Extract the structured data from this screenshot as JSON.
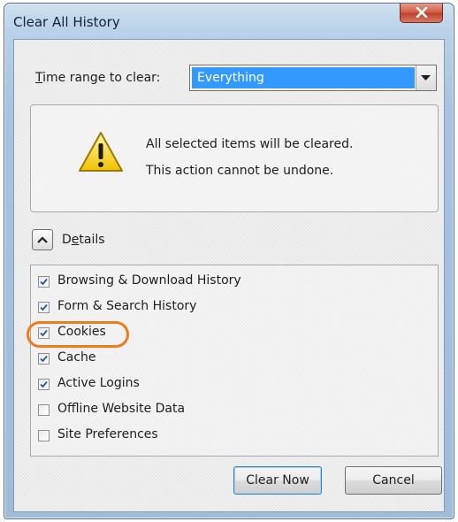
{
  "window": {
    "title": "Clear All History"
  },
  "time_range": {
    "label_accel": "T",
    "label_rest": "ime range to clear:",
    "selected": "Everything"
  },
  "warning": {
    "line1": "All selected items will be cleared.",
    "line2": "This action cannot be undone.",
    "icon": "warning-triangle-icon"
  },
  "details": {
    "label_pre": "D",
    "label_accel": "e",
    "label_post": "tails",
    "expanded": true
  },
  "items": [
    {
      "label": "Browsing & Download History",
      "checked": true
    },
    {
      "label": "Form & Search History",
      "checked": true
    },
    {
      "label": "Cookies",
      "checked": true
    },
    {
      "label": "Cache",
      "checked": true
    },
    {
      "label": "Active Logins",
      "checked": true
    },
    {
      "label": "Offline Website Data",
      "checked": false
    },
    {
      "label": "Site Preferences",
      "checked": false
    }
  ],
  "buttons": {
    "clear_now": "Clear Now",
    "cancel": "Cancel"
  },
  "colors": {
    "selection": "#3399ff",
    "highlight_ring": "#f07b1c",
    "check": "#1e5aa8"
  }
}
